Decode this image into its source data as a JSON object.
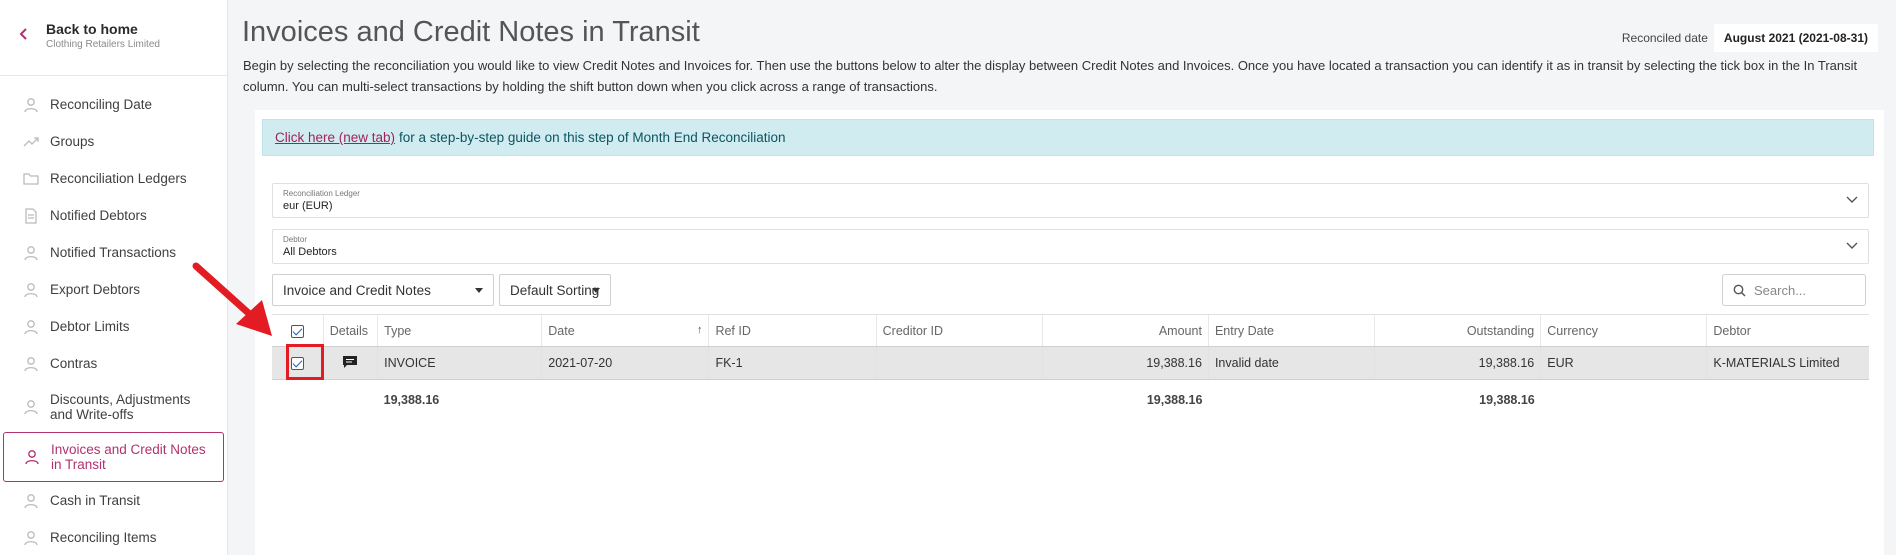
{
  "sidebar": {
    "back_title": "Back to home",
    "back_sub": "Clothing Retailers Limited",
    "items": [
      {
        "label": "Reconciling Date",
        "icon": "user-icon"
      },
      {
        "label": "Groups",
        "icon": "trend-icon"
      },
      {
        "label": "Reconciliation Ledgers",
        "icon": "folder-icon"
      },
      {
        "label": "Notified Debtors",
        "icon": "document-icon"
      },
      {
        "label": "Notified Transactions",
        "icon": "user-icon"
      },
      {
        "label": "Export Debtors",
        "icon": "user-icon"
      },
      {
        "label": "Debtor Limits",
        "icon": "user-icon"
      },
      {
        "label": "Contras",
        "icon": "user-icon"
      },
      {
        "label": "Discounts, Adjustments and Write-offs",
        "icon": "user-icon"
      },
      {
        "label": "Invoices and Credit Notes in Transit",
        "icon": "user-icon",
        "active": true
      },
      {
        "label": "Cash in Transit",
        "icon": "user-icon"
      },
      {
        "label": "Reconciling Items",
        "icon": "user-icon"
      }
    ]
  },
  "header": {
    "title": "Invoices and Credit Notes in Transit",
    "reconciled_label": "Reconciled date",
    "reconciled_value": "August 2021 (2021-08-31)",
    "description": "Begin by selecting the reconciliation you would like to view Credit Notes and Invoices for. Then use the buttons below to alter the display between Credit Notes and Invoices. Once you have located a transaction you can identify it as in transit by selecting the tick box in the In Transit column. You can multi-select transactions by holding the shift button down when you click across a range of transactions."
  },
  "info": {
    "link": "Click here (new tab)",
    "text": "for a step-by-step guide on this step of Month End Reconciliation"
  },
  "filters": {
    "ledger_label": "Reconciliation Ledger",
    "ledger_value": "eur (EUR)",
    "debtor_label": "Debtor",
    "debtor_value": "All Debtors",
    "type_select": "Invoice and Credit Notes",
    "sort_select": "Default Sorting",
    "search_placeholder": "Search..."
  },
  "table": {
    "headers": {
      "details": "Details",
      "type": "Type",
      "date": "Date",
      "ref": "Ref ID",
      "creditor": "Creditor ID",
      "amount": "Amount",
      "entry": "Entry Date",
      "outstanding": "Outstanding",
      "currency": "Currency",
      "debtor": "Debtor"
    },
    "sort_arrow": "↑",
    "rows": [
      {
        "type": "INVOICE",
        "date": "2021-07-20",
        "ref": "FK-1",
        "creditor": "",
        "amount": "19,388.16",
        "entry": "Invalid date",
        "outstanding": "19,388.16",
        "currency": "EUR",
        "debtor": "K-MATERIALS Limited",
        "checked": true
      }
    ],
    "totals": {
      "type": "19,388.16",
      "amount": "19,388.16",
      "outstanding": "19,388.16"
    }
  },
  "colors": {
    "accent": "#b2316f",
    "info_bg": "#d1ecf1",
    "highlight": "#e31b23"
  }
}
